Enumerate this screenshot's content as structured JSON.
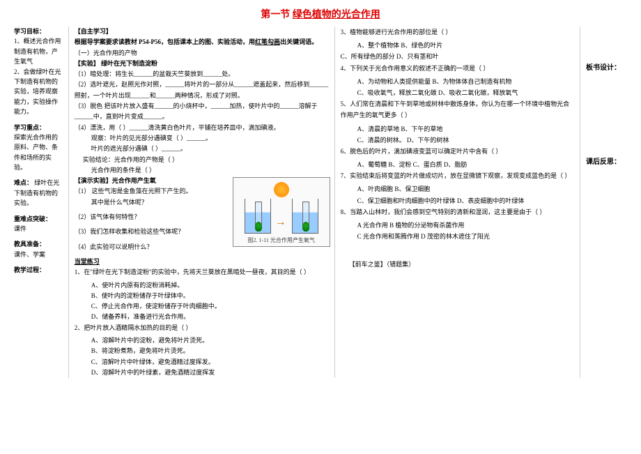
{
  "title_prefix": "第一节",
  "title_main": "绿色植物的光合作用",
  "left": {
    "obj_h": "学习目标：",
    "obj1": "1、概述光合作用制造有机物，产生氧气",
    "obj2": "2、会做绿叶在光下制造有机物的实验，培养观察能力，实验操作能力。",
    "focus_h": "学习重点：",
    "focus": "探索光合作用的原料、产物、条件和场所的实验。",
    "diff_h": "难点：",
    "diff": "绿叶在光下制造有机物的实验。",
    "break_h": "重难点突破：",
    "break": "课件",
    "prep_h": "教具准备：",
    "prep": "课件、学案",
    "proc_h": "教学过程："
  },
  "mid": {
    "self_h": "【自主学习】",
    "self_instr_a": "根据导学案要求读教材 P54-P56，包括课本上的图、实验活动，用",
    "self_instr_b": "红笔勾画",
    "self_instr_c": "出关键词语。",
    "sec1": "（一）光合作用的产物",
    "exp_h": "【实验】  绿叶在光下制造淀粉",
    "s1": "（1）暗处理：将生长______的盆栽天竺葵放到______处。",
    "s2": "（2）选叶遮光，赵照光作对照，______将叶片的一部分从______遮盖起来，然后移到______照射，一个叶片出现______和______两种情况，形成了对照。",
    "s3": "（3）脱色 把该叶片放入盛有______的小烧杯中，______加热，使叶片中的______溶解于______中，直到叶片变成______。",
    "s4a": "（4）漂洗，用（    ）______清洗黄白色叶片，平铺在培养皿中，滴加碘液。",
    "s4b": "观察：叶片的见光部分遇碘变（      ）______。",
    "s4c": "叶片的遮光部分遇碘（        ）______。",
    "s5a": "实验结论：光合作用的产物是（        ）",
    "s5b": "光合作用的条件是（        ）",
    "demo_h": "【演示实验】光合作用产生氧",
    "d1": "（1）   这些气泡是金鱼藻在光照下产生的。",
    "d1b": "其中是什么气体呢？",
    "d2": "（2）该气体有何特性？",
    "d3": "（3）我们怎样收集和检验这些气体呢？",
    "d4": "（4）此实验可以说明什么？",
    "caption": "图2. 1-11  光合作用产生氧气",
    "prac_h": "当堂练习",
    "p1": "1、在\"绿叶在光下制造淀粉\"的实验中，先将天兰葵放在黑暗处一昼夜，其目的是（    ）",
    "p1a": "A、使叶片内原有的淀粉消耗掉。",
    "p1b": "B、使叶内的淀粉储存于叶绿体中。",
    "p1c": "C、停止光合作用，使淀粉储存于叶肉细胞中。",
    "p1d": "D、储备养料，准备进行光合作用。",
    "p2": "2、把叶片放入酒精隔水加热的目的是（    ）",
    "p2a": "A、溶解叶片中的淀粉，避免将叶片烫死。",
    "p2b": "B、将淀粉煮熟，避免将叶片烫死。",
    "p2c": "C、溶解叶片中叶绿体，避免酒精过度挥发。",
    "p2d": "D、溶解叶片中的叶绿素，避免酒精过度挥发"
  },
  "right": {
    "q3": "3、植物能够进行光合作用的部位是（      ）",
    "q3ab": "A、整个植物体             B、绿色的叶片",
    "q3cd": "C、所有绿色的部分    D、只有茎和叶",
    "q4": "4、下列关于光合作用意义的叙述不正确的一项是（    ）",
    "q4a": "A、为动物和人类提供能量         B、为物体体自己制造有机物",
    "q4c": "C、吸收氧气，释放二氧化碳        D、吸收二氧化碳，释放氧气",
    "q5": "5、人们常在清晨和下午到草地或树林中散炼身体，你认为在哪一个环境中植物光合作用产生的氧气更多（    ）",
    "q5a": "A、清晨的草地    B、下午的草地",
    "q5c": "C、清晨的树林。   D、下午的树林",
    "q6": "6、脱色后的叶片，滴加碘液变蓝可以确定叶片中含有（      ）",
    "q6a": "A、葡萄糖      B、淀粉      C、蛋白质      D、脂肪",
    "q7": "7、实验结束后将变蓝的叶片做成切片，放在显微镜下观察，发现变成蓝色的是（    ）",
    "q7a": "A、叶肉细胞                      B、保卫细胞",
    "q7c": "C、保卫细胞和叶肉细胞中的叶绿体  D、表皮细胞中的叶绿体",
    "q8": "8、当踏入山林时，我们会感到空气特别的清新和湿润，这主要是由于（   ）",
    "q8a": "A 光合作用            B 植物的分泌物有杀菌作用",
    "q8c": "C 光合作用和蒸腾作用   D 茂密的林木遮住了阳光",
    "err_h": "【前车之鉴】（错题集）"
  },
  "far": {
    "board": "板书设计：",
    "reflect": "课后反思："
  }
}
